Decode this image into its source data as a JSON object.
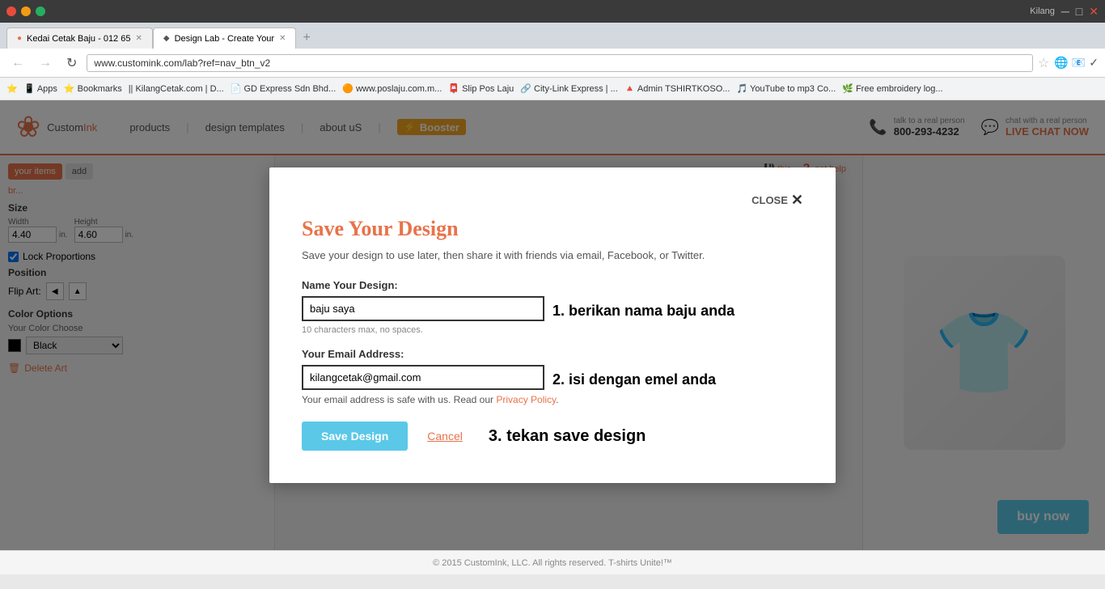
{
  "browser": {
    "url": "www.customink.com/lab?ref=nav_btn_v2",
    "tab1_label": "Kedai Cetak Baju - 012 65",
    "tab2_label": "Design Lab - Create Your",
    "bookmarks": [
      "Apps",
      "Bookmarks",
      "KilangCetak.com | D...",
      "GD Express Sdn Bhd...",
      "www.poslaju.com.m...",
      "Slip Pos Laju",
      "City-Link Express | ...",
      "Admin TSHIRTKOSO...",
      "YouTube to mp3 Co...",
      "Free embroidery log..."
    ]
  },
  "header": {
    "logo_text_custom": "Custom",
    "logo_text_ink": "Ink",
    "nav_products": "products",
    "nav_design_templates": "design templates",
    "nav_about": "about uS",
    "booster_label": "Booster",
    "phone_label": "talk to a real person",
    "phone_number": "800-293-4232",
    "chat_label": "chat with a real person",
    "chat_live": "LIVE CHAT NOW"
  },
  "left_panel": {
    "size_label": "Size",
    "width_label": "Width",
    "height_label": "Height",
    "width_value": "4.40",
    "height_value": "4.60",
    "unit": "in.",
    "lock_proportions_label": "Lock Proportions",
    "position_label": "Position",
    "flip_art_label": "Flip Art:",
    "color_options_label": "Color Options",
    "choose_color_label": "Your Color Choose",
    "color_value": "Black",
    "delete_art_label": "Delete Art"
  },
  "toolbar_right": {
    "save_this": "this",
    "get_help": "get help"
  },
  "modal": {
    "close_label": "CLOSE",
    "title": "Save Your Design",
    "subtitle_text": "Save your design to use later, then share it with friends via email, Facebook, or Twitter.",
    "name_label": "Name Your Design:",
    "name_value": "baju saya",
    "name_hint": "10 characters max, no spaces.",
    "email_label": "Your Email Address:",
    "email_value": "kilangcetak@gmail.com",
    "email_hint_text": "Your email address is safe with us. Read our",
    "privacy_policy_link": "Privacy Policy",
    "save_btn": "Save Design",
    "cancel_btn": "Cancel",
    "annotation1": "1. berikan nama baju anda",
    "annotation2": "2. isi dengan emel anda",
    "annotation3": "3. tekan save design"
  },
  "footer": {
    "text": "© 2015 CustomInk, LLC. All rights reserved.   T-shirts Unite!™"
  },
  "buy_now": "buy now"
}
